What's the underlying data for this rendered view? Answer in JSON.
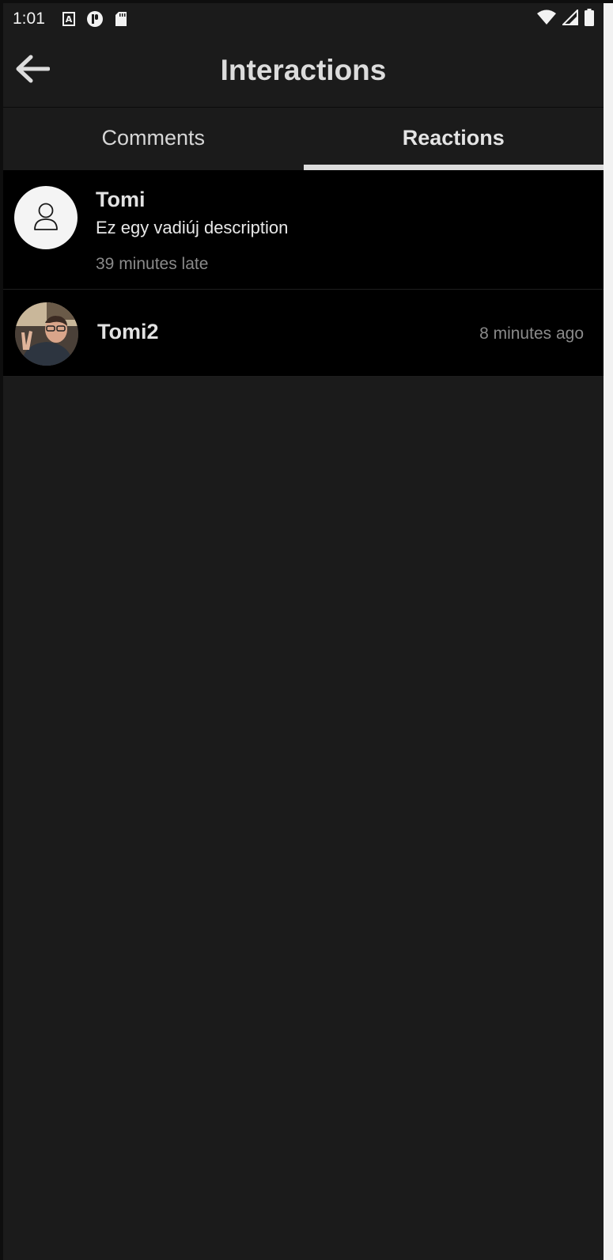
{
  "status_bar": {
    "time": "1:01",
    "left_icons": [
      "keyboard-a-icon",
      "sync-icon",
      "sd-card-icon"
    ],
    "right_icons": [
      "wifi-icon",
      "signal-icon",
      "battery-icon"
    ]
  },
  "app_bar": {
    "title": "Interactions",
    "back_icon": "arrow-left-icon"
  },
  "tabs": [
    {
      "label": "Comments",
      "active": false
    },
    {
      "label": "Reactions",
      "active": true
    }
  ],
  "items": [
    {
      "name": "Tomi",
      "comment": "Ez egy vadiúj description",
      "time": "39 minutes late",
      "avatar": "default-user-icon"
    },
    {
      "name": "Tomi2",
      "time": "8 minutes ago",
      "avatar": "profile-photo"
    }
  ],
  "colors": {
    "background": "#1b1b1b",
    "row_background": "#000000",
    "text_primary": "#e6e6e6",
    "text_secondary": "#8a8a8a",
    "tab_indicator": "#dcdcdc"
  }
}
